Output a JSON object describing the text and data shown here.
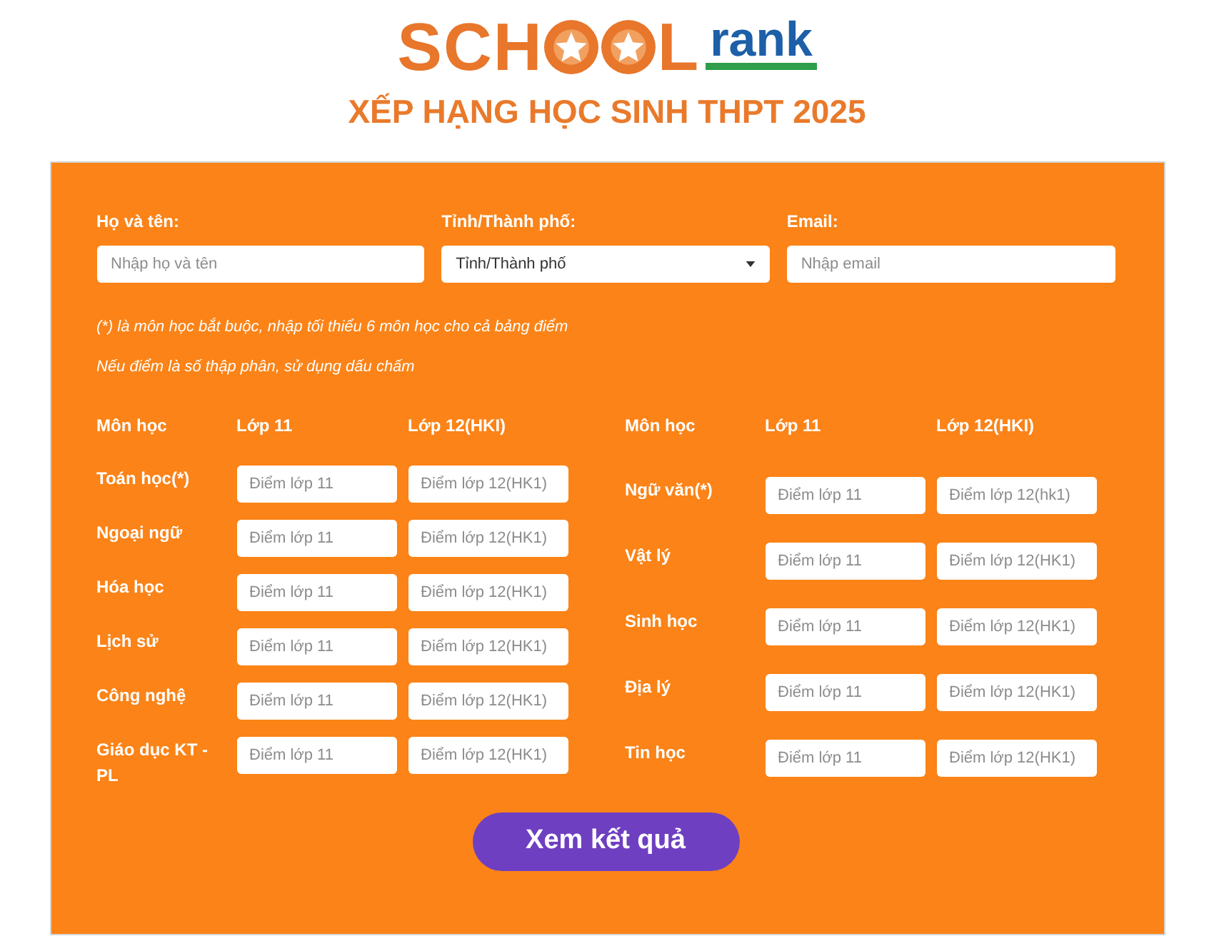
{
  "logo": {
    "lead": "SCH",
    "tail": "L",
    "suffix": "rank"
  },
  "title": "XẾP HẠNG HỌC SINH THPT 2025",
  "fields": [
    {
      "kind": "text",
      "label": "Họ và tên:",
      "placeholder": "Nhập họ và tên"
    },
    {
      "kind": "select",
      "label": "Tỉnh/Thành phố:",
      "value": "Tỉnh/Thành phố"
    },
    {
      "kind": "text",
      "label": "Email:",
      "placeholder": "Nhập email"
    }
  ],
  "notes": [
    "(*) là môn học bắt buộc, nhập tối thiểu 6 môn học cho cả bảng điểm",
    "Nếu điểm là số thập phân, sử dụng dấu chấm"
  ],
  "score_tables": [
    {
      "columns": [
        "Môn học",
        "Lớp 11",
        "Lớp 12(HKI)"
      ],
      "rows": [
        {
          "subject": "Toán học(*)",
          "placeholders": [
            "Điểm lớp 11",
            "Điểm lớp 12(HK1)"
          ]
        },
        {
          "subject": "Ngoại ngữ",
          "placeholders": [
            "Điểm lớp 11",
            "Điểm lớp 12(HK1)"
          ]
        },
        {
          "subject": "Hóa học",
          "placeholders": [
            "Điểm lớp 11",
            "Điểm lớp 12(HK1)"
          ]
        },
        {
          "subject": "Lịch sử",
          "placeholders": [
            "Điểm lớp 11",
            "Điểm lớp 12(HK1)"
          ]
        },
        {
          "subject": "Công nghệ",
          "placeholders": [
            "Điểm lớp 11",
            "Điểm lớp 12(HK1)"
          ]
        },
        {
          "subject": "Giáo dục KT - PL",
          "placeholders": [
            "Điểm lớp 11",
            "Điểm lớp 12(HK1)"
          ]
        }
      ]
    },
    {
      "columns": [
        "Môn học",
        "Lớp 11",
        "Lớp 12(HKI)"
      ],
      "rows": [
        {
          "subject": "Ngữ văn(*)",
          "placeholders": [
            "Điểm lớp 11",
            "Điểm lớp 12(hk1)"
          ]
        },
        {
          "subject": "Vật lý",
          "placeholders": [
            "Điểm lớp 11",
            "Điểm lớp 12(HK1)"
          ]
        },
        {
          "subject": "Sinh học",
          "placeholders": [
            "Điểm lớp 11",
            "Điểm lớp 12(HK1)"
          ]
        },
        {
          "subject": "Địa lý",
          "placeholders": [
            "Điểm lớp 11",
            "Điểm lớp 12(HK1)"
          ]
        },
        {
          "subject": "Tin học",
          "placeholders": [
            "Điểm lớp 11",
            "Điểm lớp 12(HK1)"
          ]
        }
      ]
    }
  ],
  "submit_button": "Xem kết quả"
}
